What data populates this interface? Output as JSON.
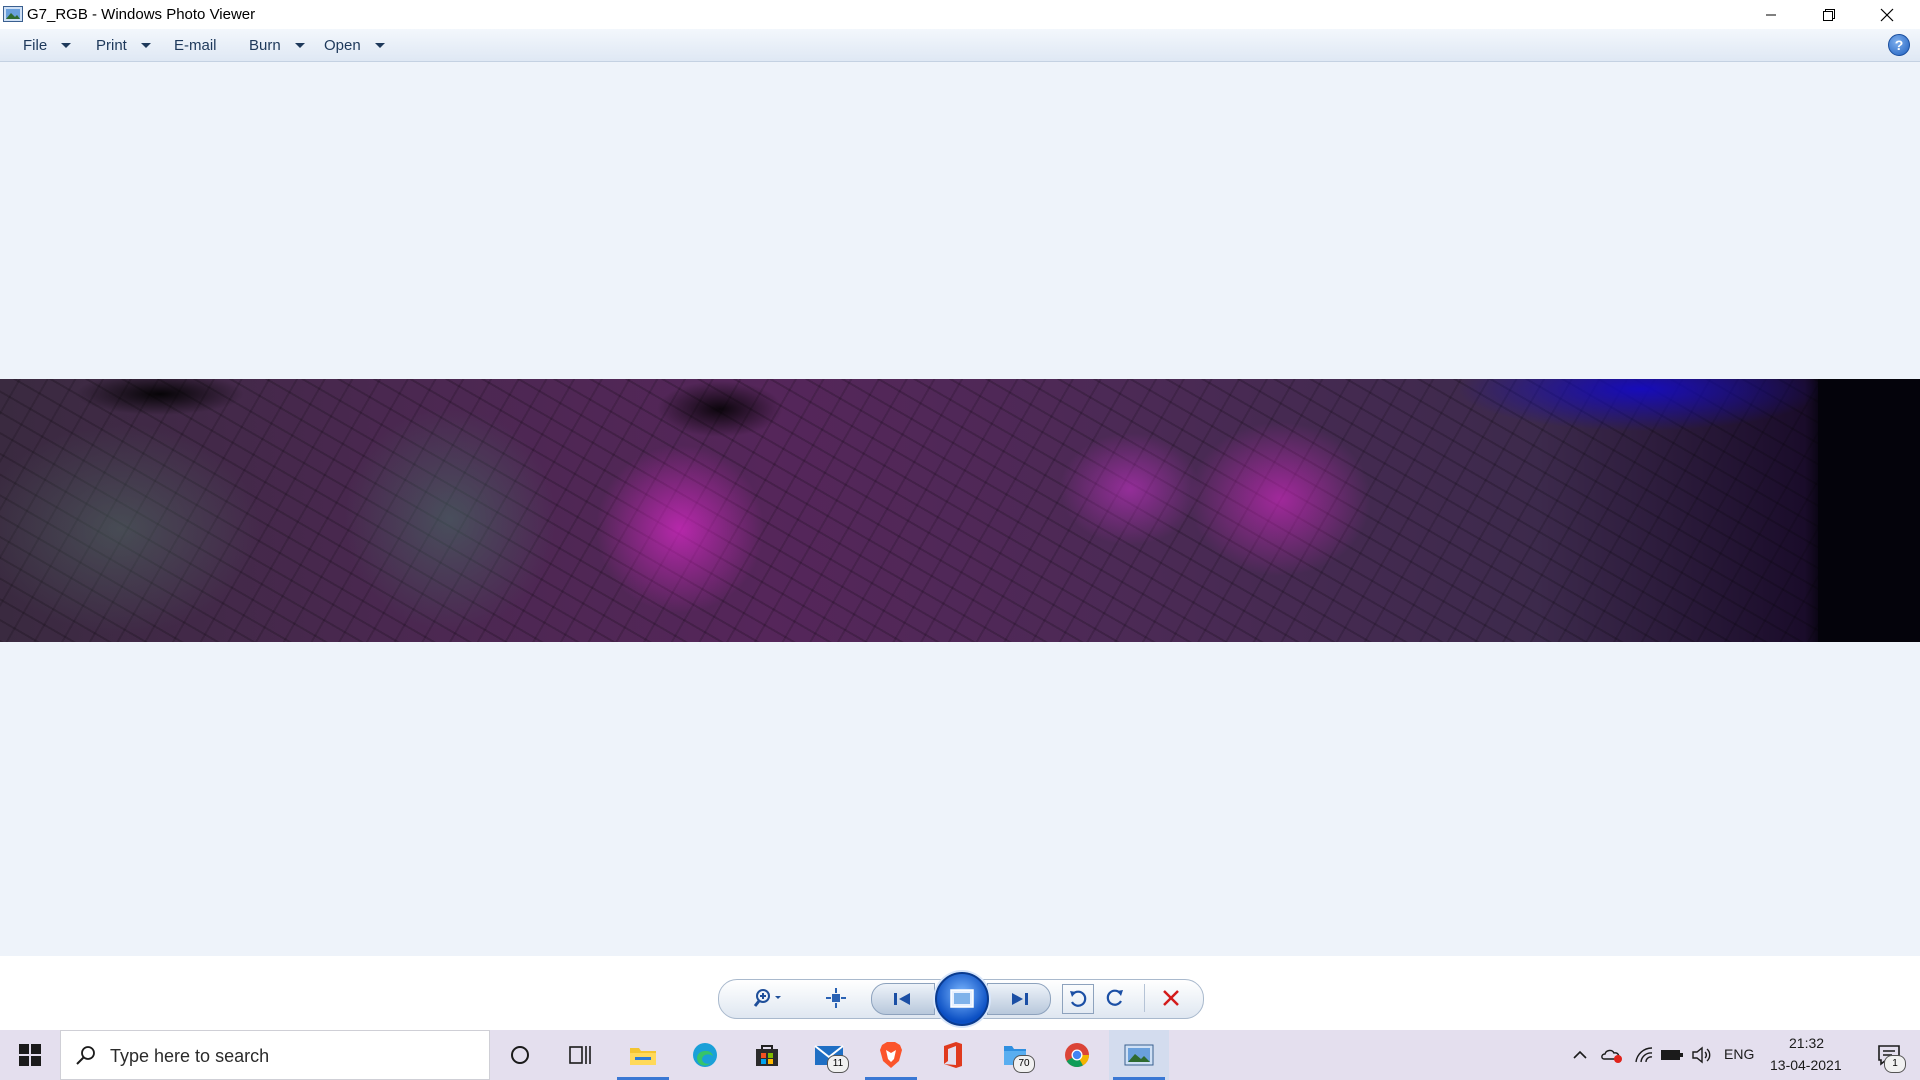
{
  "window": {
    "title": "G7_RGB - Windows Photo Viewer",
    "icons": [
      "app-photo-icon",
      "minimize-icon",
      "restore-icon",
      "close-icon"
    ]
  },
  "menu": {
    "file": "File",
    "print": "Print",
    "email": "E-mail",
    "burn": "Burn",
    "open": "Open",
    "help_glyph": "?"
  },
  "photo": {
    "description_icon": "satellite-image"
  },
  "controls": {
    "icons": [
      "zoom-icon",
      "actual-size-icon",
      "previous-icon",
      "slideshow-icon",
      "next-icon",
      "rotate-left-icon",
      "rotate-right-icon",
      "delete-icon"
    ]
  },
  "taskbar": {
    "search_placeholder": "Type here to search",
    "apps": [
      {
        "name": "cortana-icon"
      },
      {
        "name": "task-view-icon"
      },
      {
        "name": "file-explorer-icon",
        "active": true
      },
      {
        "name": "edge-icon"
      },
      {
        "name": "store-icon"
      },
      {
        "name": "mail-icon",
        "badge": "11"
      },
      {
        "name": "brave-icon",
        "active": true
      },
      {
        "name": "office-icon"
      },
      {
        "name": "files-icon",
        "badge": "70"
      },
      {
        "name": "chrome-icon"
      },
      {
        "name": "photo-viewer-icon",
        "active": true
      }
    ],
    "tray": {
      "language": "ENG",
      "time": "21:32",
      "date": "13-04-2021",
      "notification_count": "1"
    }
  },
  "colors": {
    "menubar": "#dfe8f4",
    "viewport": "#eef3fa",
    "taskbar": "#e4dfee",
    "accent": "#3a78d4"
  }
}
